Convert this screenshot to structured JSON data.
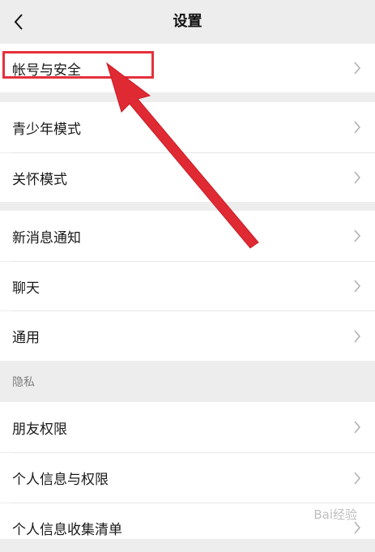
{
  "header": {
    "title": "设置",
    "back_icon": "chevron-left-icon"
  },
  "groups": [
    {
      "items": [
        {
          "label": "帐号与安全"
        }
      ]
    },
    {
      "items": [
        {
          "label": "青少年模式"
        },
        {
          "label": "关怀模式"
        }
      ]
    },
    {
      "items": [
        {
          "label": "新消息通知"
        },
        {
          "label": "聊天"
        },
        {
          "label": "通用"
        }
      ]
    }
  ],
  "privacy": {
    "section_label": "隐私",
    "items": [
      {
        "label": "朋友权限"
      },
      {
        "label": "个人信息与权限"
      },
      {
        "label": "个人信息收集清单"
      }
    ]
  },
  "annotation": {
    "highlight_color": "#e4313c",
    "arrow_color": "#e02a33"
  },
  "watermark": {
    "text": "Bai经验"
  }
}
